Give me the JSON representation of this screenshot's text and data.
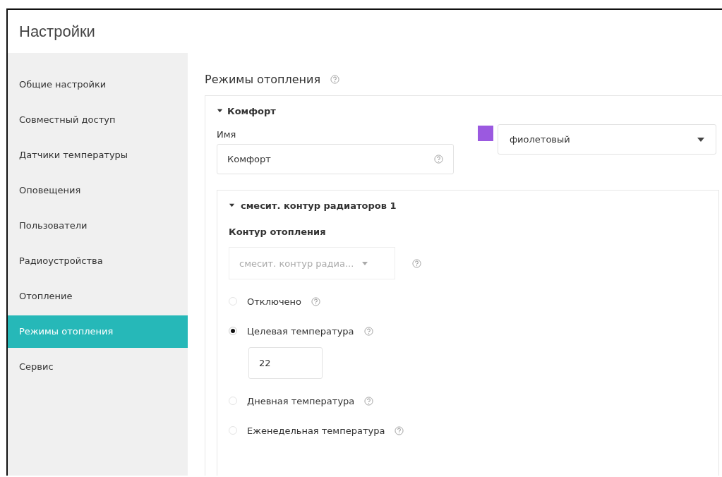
{
  "window": {
    "title": "Настройки"
  },
  "sidebar": {
    "items": [
      {
        "label": "Общие настройки",
        "selected": false
      },
      {
        "label": "Совместный доступ",
        "selected": false
      },
      {
        "label": "Датчики температуры",
        "selected": false
      },
      {
        "label": "Оповещения",
        "selected": false
      },
      {
        "label": "Пользователи",
        "selected": false
      },
      {
        "label": "Радиоустройства",
        "selected": false
      },
      {
        "label": "Отопление",
        "selected": false
      },
      {
        "label": "Режимы отопления",
        "selected": true
      },
      {
        "label": "Сервис",
        "selected": false
      }
    ]
  },
  "main": {
    "heading": "Режимы отопления",
    "mode": {
      "title": "Комфорт",
      "expanded": true,
      "name_label": "Имя",
      "name_value": "Комфорт",
      "color": "#9b59e0",
      "color_name": "фиолетовый",
      "circuit": {
        "title": "смесит. контур радиаторов 1",
        "expanded": true,
        "circuit_label": "Контур отопления",
        "circuit_value": "смесит. контур радиа...",
        "circuit_disabled": true,
        "options": [
          {
            "label": "Отключено",
            "selected": false
          },
          {
            "label": "Целевая температура",
            "selected": true,
            "value": "22"
          },
          {
            "label": "Дневная температура",
            "selected": false
          },
          {
            "label": "Еженедельная температура",
            "selected": false
          }
        ]
      }
    }
  }
}
